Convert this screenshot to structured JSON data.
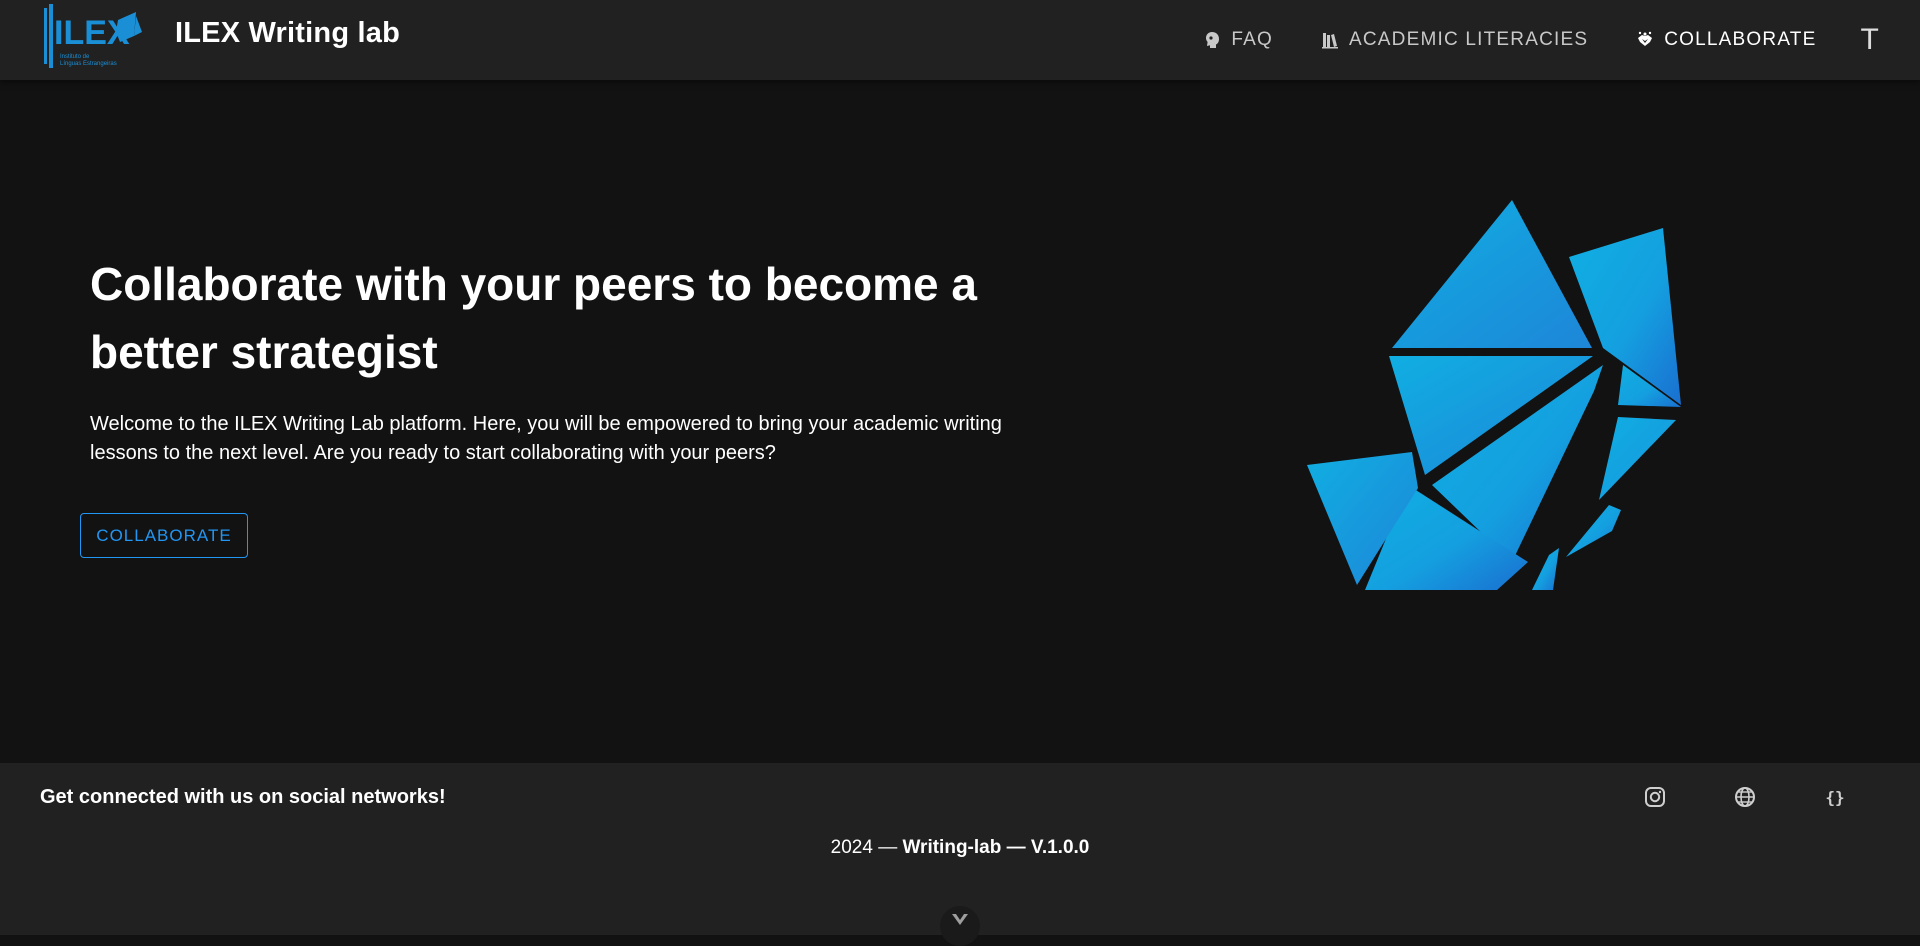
{
  "header": {
    "logo_text": "ILEX",
    "logo_subtext": "Instituto de Línguas Estrangeiras",
    "brand": "ILEX Writing lab",
    "nav": [
      {
        "label": "FAQ",
        "icon": "brain-icon"
      },
      {
        "label": "ACADEMIC LITERACIES",
        "icon": "books-icon"
      },
      {
        "label": "COLLABORATE",
        "icon": "handshake-icon"
      }
    ],
    "extra_label": "T"
  },
  "hero": {
    "title": "Collaborate with your peers to become a better strategist",
    "text": "Welcome to the ILEX Writing Lab platform. Here, you will be empowered to bring your academic writing lessons to the next level. Are you ready to start collaborating with your peers?",
    "cta": "COLLABORATE"
  },
  "footer": {
    "social_text": "Get connected with us on social networks!",
    "socials": [
      "instagram-icon",
      "globe-icon",
      "code-braces-icon"
    ],
    "year": "2024",
    "separator": "—",
    "project": "Writing-lab",
    "version": "V.1.0.0"
  },
  "colors": {
    "background": "#121212",
    "header": "#212121",
    "accent": "#2196f3",
    "art_light": "#10aee2",
    "art_dark": "#1a6fd0"
  }
}
